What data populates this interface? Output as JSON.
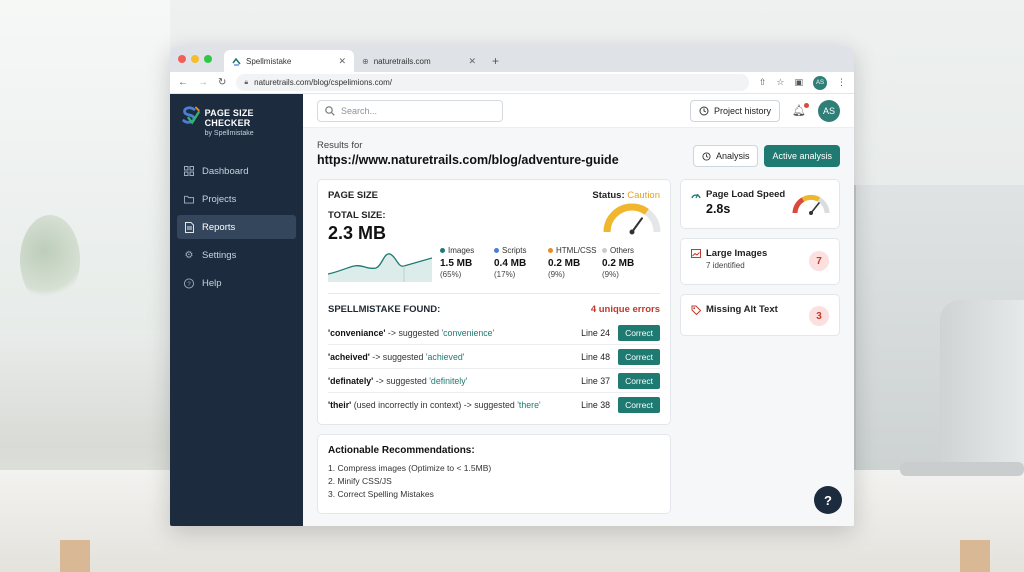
{
  "browser": {
    "tabs": [
      {
        "label": "Spellmistake",
        "active": true
      },
      {
        "label": "naturetrails.com",
        "active": false
      }
    ],
    "url": "naturetrails.com/blog/cspelimions.com/",
    "profile_initials": "AS"
  },
  "sidebar": {
    "brand_title": "PAGE SIZE CHECKER",
    "brand_sub": "by Spellmistake",
    "items": [
      {
        "label": "Dashboard",
        "icon": "grid-icon"
      },
      {
        "label": "Projects",
        "icon": "folder-icon"
      },
      {
        "label": "Reports",
        "icon": "document-icon",
        "active": true
      },
      {
        "label": "Settings",
        "icon": "gear-icon"
      },
      {
        "label": "Help",
        "icon": "question-icon"
      }
    ]
  },
  "topbar": {
    "search_placeholder": "Search...",
    "project_history_label": "Project history",
    "avatar_initials": "AS"
  },
  "results": {
    "label": "Results for",
    "url": "https://www.naturetrails.com/blog/adventure-guide",
    "analysis_label": "Analysis",
    "active_analysis_label": "Active analysis"
  },
  "page_size": {
    "title": "PAGE SIZE",
    "status_label": "Status:",
    "status_value": "Caution",
    "total_label": "TOTAL SIZE:",
    "total_value": "2.3 MB",
    "gauge_level": 0.7,
    "breakdown": [
      {
        "name": "Images",
        "value": "1.5 MB",
        "pct": "(65%)",
        "color": "#1f7a72"
      },
      {
        "name": "Scripts",
        "value": "0.4 MB",
        "pct": "(17%)",
        "color": "#4a7fd6"
      },
      {
        "name": "HTML/CSS",
        "value": "0.2 MB",
        "pct": "(9%)",
        "color": "#e98b2c"
      },
      {
        "name": "Others",
        "value": "0.2 MB",
        "pct": "(9%)",
        "color": "#c7ccd1"
      }
    ]
  },
  "spellmistake": {
    "title": "SPELLMISTAKE FOUND:",
    "count_label": "4 unique errors",
    "rows": [
      {
        "wrong": "'conveniance'",
        "mid": " -> suggested ",
        "right": "'convenience'",
        "line": "Line 24",
        "action": "Correct"
      },
      {
        "wrong": "'acheived'",
        "mid": " -> suggested ",
        "right": "'achieved'",
        "line": "Line 48",
        "action": "Correct"
      },
      {
        "wrong": "'definately'",
        "mid": " -> suggested ",
        "right": "'definitely'",
        "line": "Line 37",
        "action": "Correct"
      },
      {
        "wrong": "'their'",
        "mid": " (used incorrectly in context) -> suggested ",
        "right": "'there'",
        "line": "Line 38",
        "action": "Correct"
      }
    ]
  },
  "recommendations": {
    "title": "Actionable Recommendations:",
    "items": [
      "1. Compress images (Optimize to < 1.5MB)",
      "2. Minify CSS/JS",
      "3. Correct Spelling Mistakes"
    ]
  },
  "side_cards": {
    "load_speed": {
      "title": "Page Load Speed",
      "value": "2.8s"
    },
    "large_images": {
      "title": "Large Images",
      "sub": "7 identified",
      "count": "7"
    },
    "missing_alt": {
      "title": "Missing Alt Text",
      "count": "3"
    }
  },
  "help_fab": "?",
  "colors": {
    "sidebar_bg": "#1c2b3d",
    "accent_teal": "#1f7a72",
    "caution": "#e6a31f",
    "error_red": "#c0392b"
  }
}
